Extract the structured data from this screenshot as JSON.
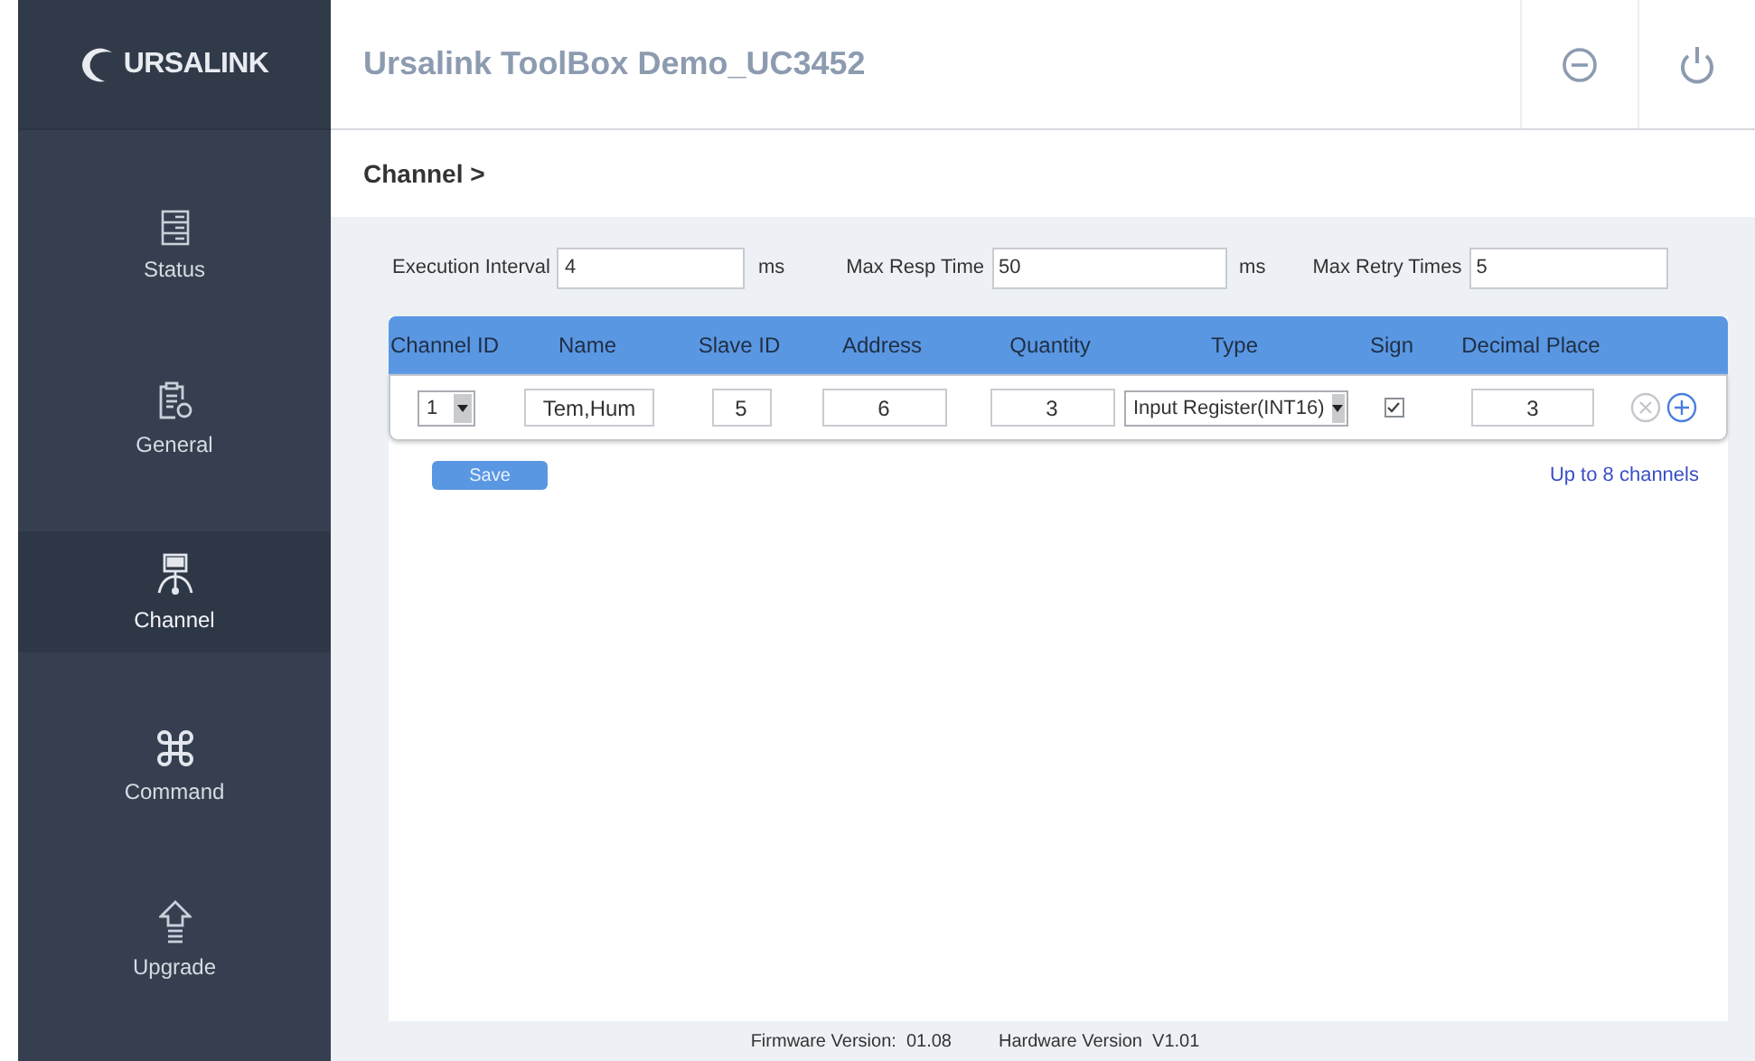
{
  "sidebar": {
    "logo": "URSALINK",
    "items": [
      {
        "kind": "status",
        "label": "Status",
        "selected": false
      },
      {
        "kind": "general",
        "label": "General",
        "selected": false
      },
      {
        "kind": "channel",
        "label": "Channel",
        "selected": true
      },
      {
        "kind": "command",
        "label": "Command",
        "selected": false
      },
      {
        "kind": "upgrade",
        "label": "Upgrade",
        "selected": false
      }
    ]
  },
  "header": {
    "title": "Ursalink ToolBox Demo_UC3452"
  },
  "breadcrumb": "Channel >",
  "settings": [
    {
      "label": "Execution Interval",
      "value": "4",
      "unit": "ms"
    },
    {
      "label": "Max Resp Time",
      "value": "50",
      "unit": "ms"
    },
    {
      "label": "Max Retry Times",
      "value": "5"
    }
  ],
  "table": {
    "columns": [
      "Channel ID",
      "Name",
      "Slave ID",
      "Address",
      "Quantity",
      "Type",
      "Sign",
      "Decimal Place"
    ],
    "rows": [
      {
        "channel_id": "1",
        "name": "Tem,Hum",
        "slave_id": "5",
        "address": "6",
        "quantity": "3",
        "type": "Input Register(INT16)",
        "sign_checked": true,
        "decimal_place": "3"
      }
    ]
  },
  "save_button": "Save",
  "limit_note": "Up to 8 channels",
  "footer": [
    {
      "label": "Firmware Version:",
      "value": "01.08"
    },
    {
      "label": "Hardware Version",
      "value": "V1.01"
    }
  ]
}
